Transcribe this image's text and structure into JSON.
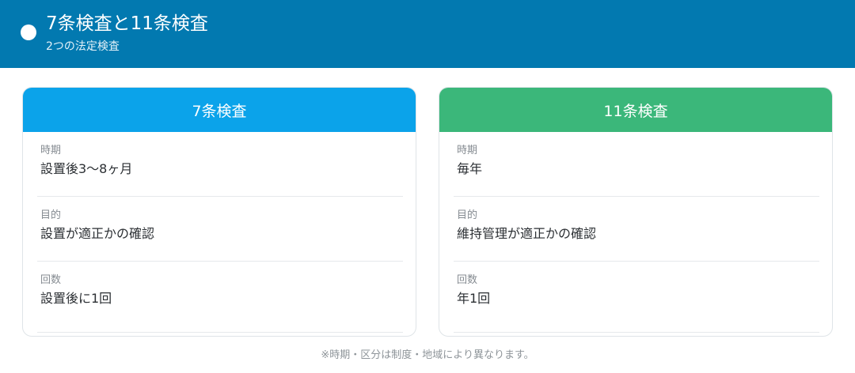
{
  "header": {
    "title": "7条検査と11条検査",
    "subtitle": "2つの法定検査"
  },
  "colors": {
    "header_bg": "#0279b0",
    "card_left_accent": "#0ba3ea",
    "card_right_accent": "#3bb77a"
  },
  "cards": [
    {
      "title": "7条検査",
      "rows": [
        {
          "label": "時期",
          "value": "設置後3〜8ヶ月"
        },
        {
          "label": "目的",
          "value": "設置が適正かの確認"
        },
        {
          "label": "回数",
          "value": "設置後に1回"
        }
      ]
    },
    {
      "title": "11条検査",
      "rows": [
        {
          "label": "時期",
          "value": "毎年"
        },
        {
          "label": "目的",
          "value": "維持管理が適正かの確認"
        },
        {
          "label": "回数",
          "value": "年1回"
        }
      ]
    }
  ],
  "footnote": "※時期・区分は制度・地域により異なります。"
}
